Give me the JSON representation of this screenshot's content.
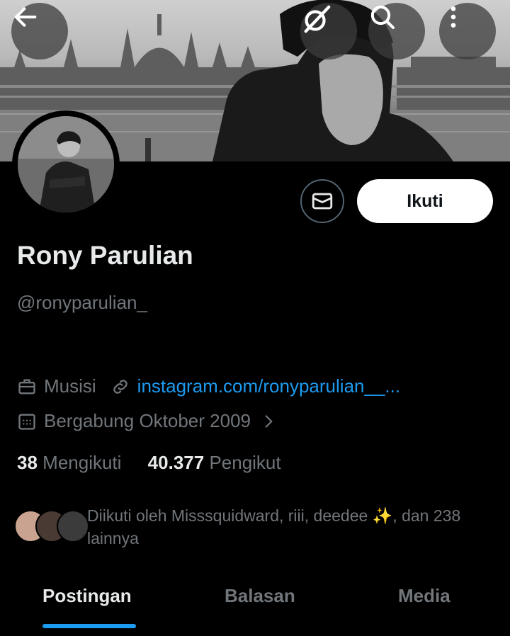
{
  "header": {
    "back_icon": "arrow-left-icon",
    "grok_icon": "grok-icon",
    "search_icon": "search-icon",
    "more_icon": "more-vertical-icon"
  },
  "profile": {
    "name": "Rony Parulian",
    "handle": "@ronyparulian_",
    "follow_label": "Ikuti",
    "profession": "Musisi",
    "website": "instagram.com/ronyparulian__...",
    "joined": "Bergabung Oktober 2009",
    "following_count": "38",
    "following_label": "Mengikuti",
    "followers_count": "40.377",
    "followers_label": "Pengikut",
    "followed_by": "Diikuti oleh Misssquidward, riii, deedee ✨, dan 238 lainnya"
  },
  "tabs": [
    {
      "label": "Postingan",
      "active": true
    },
    {
      "label": "Balasan",
      "active": false
    },
    {
      "label": "Media",
      "active": false
    }
  ],
  "colors": {
    "accent": "#1d9bf0",
    "background": "#000000",
    "secondary_text": "#71767b"
  }
}
